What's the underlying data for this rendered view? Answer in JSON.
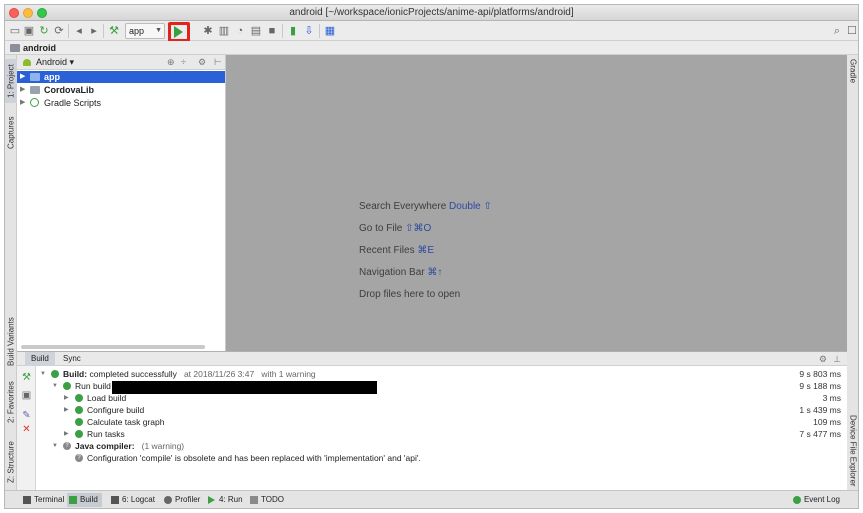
{
  "window": {
    "title": "android [~/workspace/ionicProjects/anime-api/platforms/android]"
  },
  "toolbar": {
    "run_config_label": "app",
    "icons": [
      "open-folder-icon",
      "save-icon",
      "sync-icon",
      "back-icon",
      "forward-icon",
      "build-hammer-icon",
      "run-icon",
      "debug-icon",
      "profile-icon",
      "stop-icon",
      "sdk-manager-icon",
      "avd-manager-icon",
      "search-icon",
      "user-icon"
    ]
  },
  "breadcrumb": {
    "label": "android"
  },
  "left_stripe": {
    "project_tab": "1: Project",
    "captures_tab": "Captures",
    "build_variants_tab": "Build Variants",
    "favorites_tab": "2: Favorites",
    "structure_tab": "Z: Structure"
  },
  "right_stripe": {
    "gradle_tab": "Gradle",
    "device_file_explorer_tab": "Device File Explorer"
  },
  "project_panel": {
    "view_selector": "Android",
    "tree": [
      {
        "label": "app",
        "selected": true
      },
      {
        "label": "CordovaLib",
        "selected": false
      },
      {
        "label": "Gradle Scripts",
        "selected": false
      }
    ]
  },
  "editor": {
    "hints": [
      {
        "text": "Search Everywhere",
        "key": "Double ⇧"
      },
      {
        "text": "Go to File",
        "key": "⇧⌘O"
      },
      {
        "text": "Recent Files",
        "key": "⌘E"
      },
      {
        "text": "Navigation Bar",
        "key": "⌘↑"
      },
      {
        "text": "Drop files here to open",
        "key": ""
      }
    ]
  },
  "build_panel": {
    "tabs": [
      "Build",
      "Sync"
    ],
    "active_tab": "Build",
    "rows": {
      "summary": {
        "label": "Build:",
        "status": "completed successfully",
        "at": "at 2018/11/26 3:47",
        "warning": "with 1 warning",
        "time": "9 s 803 ms"
      },
      "run_build": {
        "label": "Run build",
        "time": "9 s 188 ms"
      },
      "load_build": {
        "label": "Load build",
        "time": "3 ms"
      },
      "configure_build": {
        "label": "Configure build",
        "time": "1 s 439 ms"
      },
      "calc_task_graph": {
        "label": "Calculate task graph",
        "time": "109 ms"
      },
      "run_tasks": {
        "label": "Run tasks",
        "time": "7 s 477 ms"
      },
      "java_compiler": {
        "label": "Java compiler:",
        "note": "(1 warning)"
      },
      "warning_msg": {
        "text": "Configuration 'compile' is obsolete and has been replaced with 'implementation' and 'api'."
      }
    }
  },
  "statusbar": {
    "items": [
      {
        "label": "Terminal"
      },
      {
        "label": "Build"
      },
      {
        "label": "6: Logcat"
      },
      {
        "label": "Profiler"
      },
      {
        "label": "4: Run"
      },
      {
        "label": "TODO"
      }
    ],
    "event_log": "Event Log"
  },
  "colors": {
    "selection": "#2a61d6",
    "run_highlight": "#e2231a",
    "success": "#3aa043",
    "editor_bg": "#a5a5a5"
  }
}
